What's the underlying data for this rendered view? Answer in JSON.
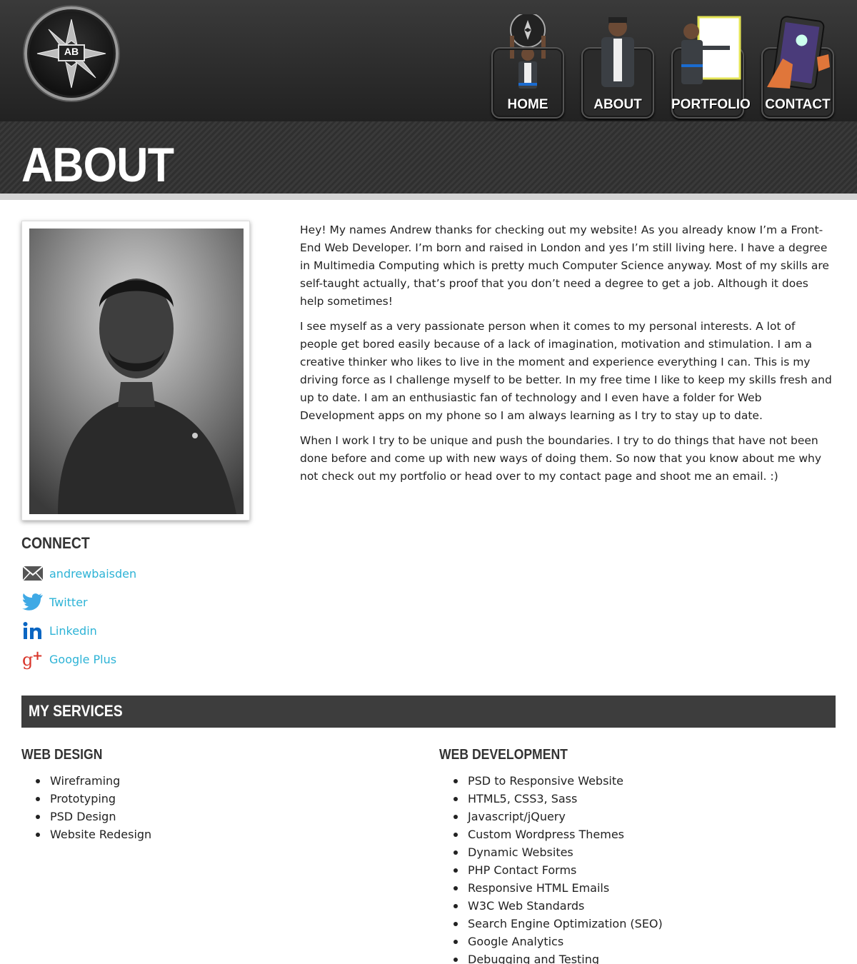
{
  "logo": {
    "text": "AB"
  },
  "nav": [
    {
      "label": "HOME"
    },
    {
      "label": "ABOUT"
    },
    {
      "label": "PORTFOLIO"
    },
    {
      "label": "CONTACT"
    }
  ],
  "page_title": "ABOUT",
  "bio": {
    "paragraphs": [
      "Hey! My names Andrew thanks for checking out my website! As you already know I’m a Front-End Web Developer. I’m born and raised in London and yes I’m still living here. I have a degree in Multimedia Computing which is pretty much Computer Science anyway. Most of my skills are self-taught actually, that’s proof that you don’t need a degree to get a job. Although it does help sometimes!",
      "I see myself as a very passionate person when it comes to my personal interests. A lot of people get bored easily because of a lack of imagination, motivation and stimulation. I am a creative thinker who likes to live in the moment and experience everything I can. This is my driving force as I challenge myself to be better. In my free time I like to keep my skills fresh and up to date. I am an enthusiastic fan of technology and I even have a folder for Web Development apps on my phone so I am always learning as I try to stay up to date.",
      "When I work I try to be unique and push the boundaries. I try to do things that have not been done before and come up with new ways of doing them. So now that you know about me why not check out my portfolio or head over to my contact page and shoot me an email. :)"
    ]
  },
  "connect": {
    "title": "CONNECT",
    "links": [
      {
        "label": "andrewbaisden",
        "icon": "envelope-icon"
      },
      {
        "label": "Twitter",
        "icon": "twitter-icon"
      },
      {
        "label": "Linkedin",
        "icon": "linkedin-icon"
      },
      {
        "label": "Google Plus",
        "icon": "google-plus-icon"
      }
    ]
  },
  "services": {
    "title": "MY SERVICES",
    "web_design": {
      "title": "WEB DESIGN",
      "items": [
        "Wireframing",
        "Prototyping",
        "PSD Design",
        "Website Redesign"
      ]
    },
    "web_development": {
      "title": "WEB DEVELOPMENT",
      "items": [
        "PSD to Responsive Website",
        "HTML5, CSS3, Sass",
        "Javascript/jQuery",
        "Custom Wordpress Themes",
        "Dynamic Websites",
        "PHP Contact Forms",
        "Responsive HTML Emails",
        "W3C Web Standards",
        "Search Engine Optimization (SEO)",
        "Google Analytics",
        "Debugging and Testing"
      ]
    }
  },
  "colors": {
    "link": "#2db3d6",
    "header_dark": "#2b2b2b",
    "services_bar": "#3d3d3d"
  }
}
